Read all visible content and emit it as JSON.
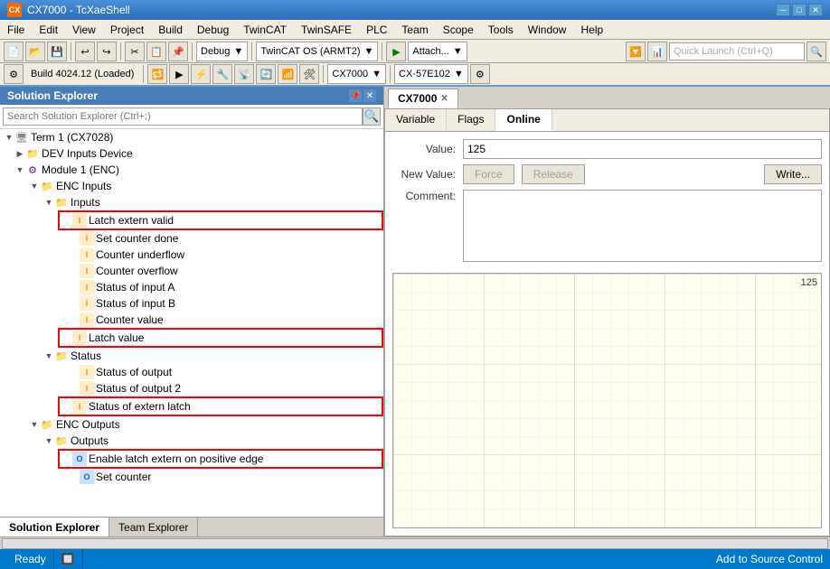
{
  "titlebar": {
    "title": "CX7000 - TcXaeShell",
    "icon": "CX"
  },
  "menubar": {
    "items": [
      "File",
      "Edit",
      "View",
      "Project",
      "Build",
      "Debug",
      "TwinCAT",
      "TwinSAFE",
      "PLC",
      "Team",
      "Scope",
      "Tools",
      "Window",
      "Help"
    ]
  },
  "toolbar": {
    "debug_dropdown": "Debug",
    "twincat_dropdown": "TwinCAT OS (ARMT2)",
    "attach_dropdown": "Attach...",
    "cx7000_dropdown": "CX7000",
    "cx57e102_dropdown": "CX-57E102",
    "build_status": "Build 4024.12 (Loaded)"
  },
  "solution_explorer": {
    "title": "Solution Explorer",
    "search_placeholder": "Search Solution Explorer (Ctrl+;)",
    "tree": [
      {
        "id": "term1",
        "label": "Term 1 (CX7028)",
        "level": 0,
        "expanded": true,
        "icon": "term"
      },
      {
        "id": "dev_inputs",
        "label": "DEV Inputs Device",
        "level": 1,
        "expanded": false,
        "icon": "folder"
      },
      {
        "id": "module1",
        "label": "Module 1 (ENC)",
        "level": 1,
        "expanded": true,
        "icon": "module"
      },
      {
        "id": "enc_inputs",
        "label": "ENC Inputs",
        "level": 2,
        "expanded": true,
        "icon": "folder"
      },
      {
        "id": "inputs",
        "label": "Inputs",
        "level": 3,
        "expanded": true,
        "icon": "folder"
      },
      {
        "id": "latch_extern_valid",
        "label": "Latch extern valid",
        "level": 4,
        "expanded": false,
        "icon": "input",
        "highlighted": true
      },
      {
        "id": "set_counter_done",
        "label": "Set counter done",
        "level": 4,
        "expanded": false,
        "icon": "input"
      },
      {
        "id": "counter_underflow",
        "label": "Counter underflow",
        "level": 4,
        "expanded": false,
        "icon": "input"
      },
      {
        "id": "counter_overflow",
        "label": "Counter overflow",
        "level": 4,
        "expanded": false,
        "icon": "input"
      },
      {
        "id": "status_input_a",
        "label": "Status of input A",
        "level": 4,
        "expanded": false,
        "icon": "input"
      },
      {
        "id": "status_input_b",
        "label": "Status of input B",
        "level": 4,
        "expanded": false,
        "icon": "input"
      },
      {
        "id": "counter_value",
        "label": "Counter value",
        "level": 4,
        "expanded": false,
        "icon": "input"
      },
      {
        "id": "latch_value",
        "label": "Latch value",
        "level": 4,
        "expanded": false,
        "icon": "input",
        "highlighted": true
      },
      {
        "id": "status",
        "label": "Status",
        "level": 3,
        "expanded": true,
        "icon": "folder"
      },
      {
        "id": "status_output",
        "label": "Status of output",
        "level": 4,
        "expanded": false,
        "icon": "input"
      },
      {
        "id": "status_output2",
        "label": "Status of output 2",
        "level": 4,
        "expanded": false,
        "icon": "input"
      },
      {
        "id": "status_extern_latch",
        "label": "Status of extern latch",
        "level": 4,
        "expanded": false,
        "icon": "input",
        "highlighted": true
      },
      {
        "id": "enc_outputs",
        "label": "ENC Outputs",
        "level": 2,
        "expanded": true,
        "icon": "folder"
      },
      {
        "id": "outputs",
        "label": "Outputs",
        "level": 3,
        "expanded": true,
        "icon": "folder"
      },
      {
        "id": "enable_latch",
        "label": "Enable latch extern on positive edge",
        "level": 4,
        "expanded": false,
        "icon": "output",
        "highlighted": true
      },
      {
        "id": "set_counter",
        "label": "Set counter",
        "level": 4,
        "expanded": false,
        "icon": "output"
      }
    ]
  },
  "cx7000_panel": {
    "tab_title": "CX7000",
    "tabs": [
      {
        "id": "variable",
        "label": "Variable"
      },
      {
        "id": "flags",
        "label": "Flags"
      },
      {
        "id": "online",
        "label": "Online",
        "active": true
      }
    ],
    "online": {
      "value_label": "Value:",
      "value": "125",
      "new_value_label": "New Value:",
      "force_btn": "Force",
      "release_btn": "Release",
      "write_btn": "Write...",
      "comment_label": "Comment:",
      "chart_value": "125"
    }
  },
  "statusbar": {
    "status": "Ready",
    "source_control": "Add to Source Control"
  },
  "bottom_tabs": [
    {
      "id": "solution",
      "label": "Solution Explorer",
      "active": true
    },
    {
      "id": "team",
      "label": "Team Explorer"
    }
  ],
  "icons": {
    "expand": "▼",
    "collapse": "▶",
    "search": "🔍",
    "minimize": "─",
    "maximize": "□",
    "close": "✕",
    "pin": "📌",
    "forward": "▶",
    "backward": "◀"
  }
}
